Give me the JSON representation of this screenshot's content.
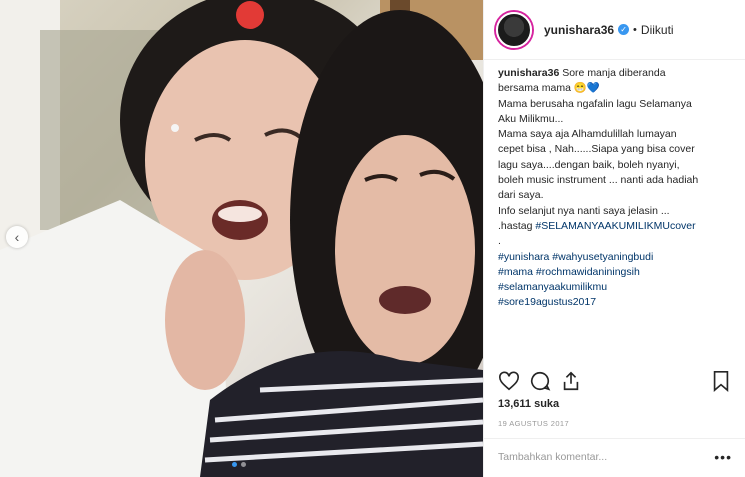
{
  "post": {
    "username": "yunishara36",
    "verified": true,
    "separator": "•",
    "follow_status": "Diikuti",
    "caption_user": "yunishara36",
    "caption_lines": [
      "Sore manja diberanda",
      "bersama mama 😁💙",
      "Mama berusaha ngafalin lagu Selamanya",
      "Aku Milikmu...",
      "Mama saya aja Alhamdulillah lumayan",
      "cepet bisa , Nah......Siapa yang bisa cover",
      "lagu saya....dengan baik, boleh nyanyi,",
      "boleh music instrument ... nanti ada hadiah",
      "dari saya.",
      "Info selanjut nya nanti saya jelasin ...",
      ".hastag"
    ],
    "hashtag_inline": "#SELAMANYAAKUMILIKMUcover",
    "dot_line": ".",
    "hashtags": [
      "#yunishara #wahyusetyaningbudi",
      "#mama #rochmawidaniningsih",
      "#selamanyaakumilikmu",
      "#sore19agustus2017"
    ],
    "likes": "13,611 suka",
    "date": "19 AGUSTUS 2017",
    "comment_placeholder": "Tambahkan komentar...",
    "more": "•••"
  },
  "icons": {
    "like": "heart-icon",
    "comment": "comment-icon",
    "share": "share-icon",
    "save": "bookmark-icon",
    "prev": "chevron-left-icon"
  },
  "colors": {
    "accent": "#3897f0",
    "hashtag": "#003569",
    "muted": "#999999"
  }
}
